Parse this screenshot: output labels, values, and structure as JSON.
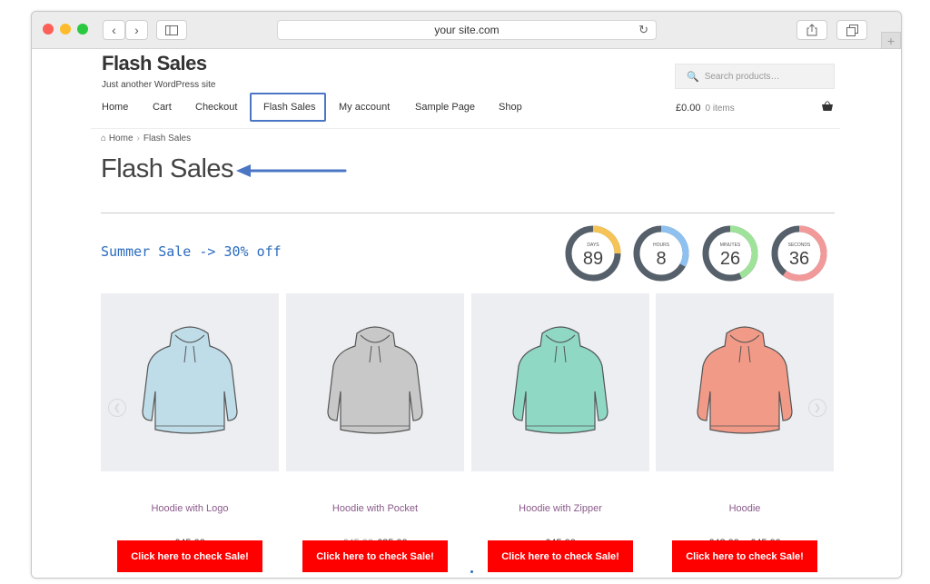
{
  "browser": {
    "url": "your site.com",
    "back": "‹",
    "forward": "›",
    "reload": "↻",
    "new_tab": "+"
  },
  "site": {
    "title": "Flash Sales",
    "tagline": "Just another WordPress site"
  },
  "search": {
    "placeholder": "Search products…"
  },
  "nav": {
    "items": [
      "Home",
      "Cart",
      "Checkout",
      "Flash Sales",
      "My account",
      "Sample Page",
      "Shop"
    ],
    "active": "Flash Sales"
  },
  "cart": {
    "total": "£0.00",
    "count": "0 items"
  },
  "breadcrumb": {
    "home": "Home",
    "separator": "›",
    "current": "Flash Sales"
  },
  "page": {
    "title": "Flash Sales"
  },
  "sale": {
    "headline": "Summer Sale -> 30% off"
  },
  "countdown": [
    {
      "label": "DAYS",
      "value": "89",
      "color": "#f5c356",
      "fraction": 0.25
    },
    {
      "label": "HOURS",
      "value": "8",
      "color": "#8ec0f0",
      "fraction": 0.33
    },
    {
      "label": "MINUTES",
      "value": "26",
      "color": "#9fe39a",
      "fraction": 0.43
    },
    {
      "label": "SECONDS",
      "value": "36",
      "color": "#f29a9a",
      "fraction": 0.6
    }
  ],
  "products": [
    {
      "name": "Hoodie with Logo",
      "price": "£45.00",
      "old_price": "",
      "button": "Click here to check Sale!",
      "color": "#bfdde8"
    },
    {
      "name": "Hoodie with Pocket",
      "price": "£35.00",
      "old_price": "£45.00",
      "button": "Click here to check Sale!",
      "color": "#c8c8c8"
    },
    {
      "name": "Hoodie with Zipper",
      "price": "£45.00",
      "old_price": "",
      "button": "Click here to check Sale!",
      "color": "#8ed8c4"
    },
    {
      "name": "Hoodie",
      "price": "£42.00 – £45.00",
      "old_price": "",
      "button": "Click here to check Sale!",
      "color": "#f29a88"
    }
  ],
  "colors": {
    "accent": "#4a76c4",
    "cta": "#ff0000",
    "sale_text": "#2b6bbd",
    "product_name": "#8a5a8a"
  }
}
